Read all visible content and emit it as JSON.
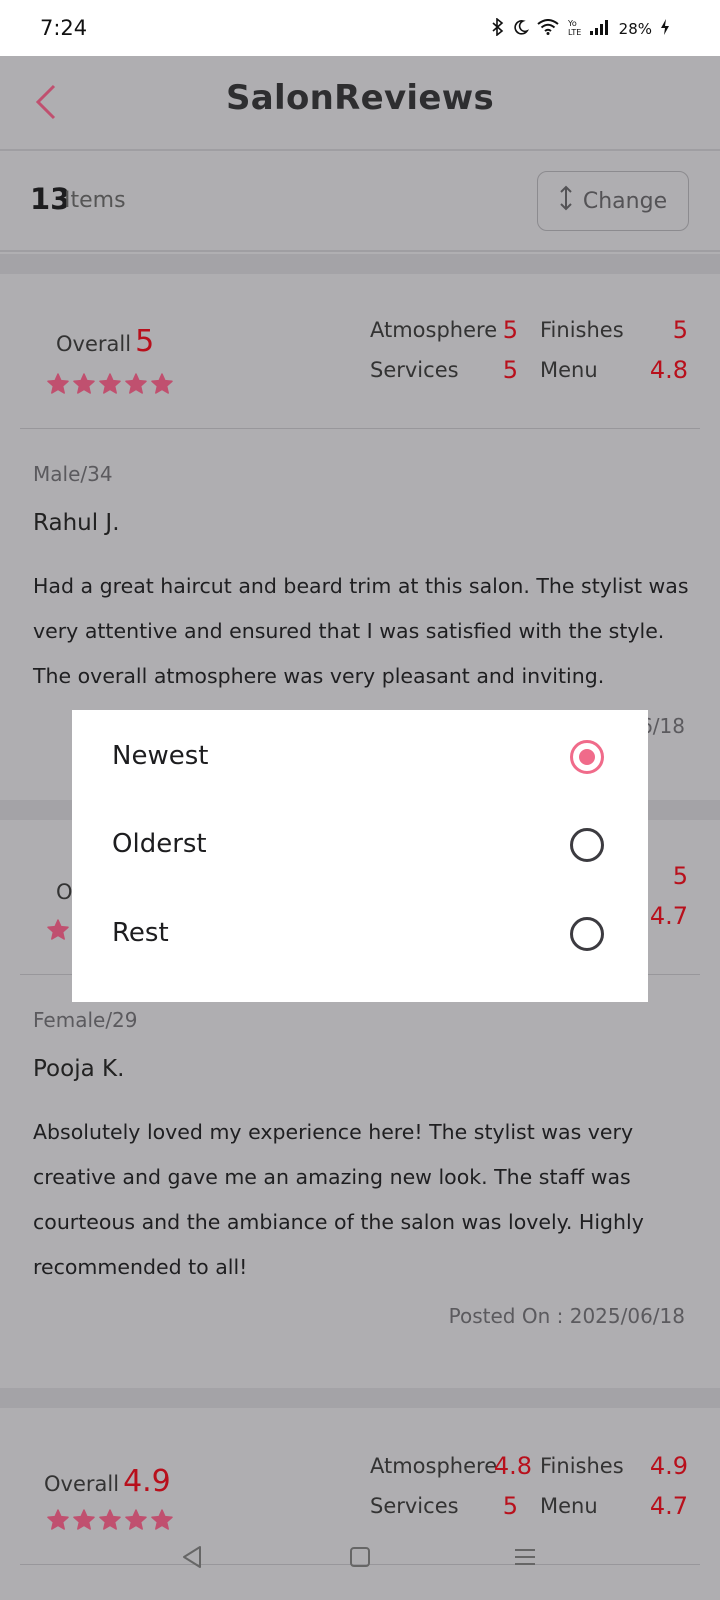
{
  "status_bar": {
    "time": "7:24",
    "icons": [
      "bluetooth-icon",
      "moon-icon",
      "wifi-icon",
      "volte-icon",
      "signal-icon"
    ],
    "battery": "28%"
  },
  "header": {
    "title": "SalonReviews",
    "back_icon": "chevron-left-icon"
  },
  "items_bar": {
    "count": "13",
    "label": "Items",
    "change_label": "Change",
    "change_icon": "sort-arrows-icon"
  },
  "reviews": [
    {
      "overall_label": "Overall",
      "overall_value": "5",
      "stars": 5,
      "metrics": [
        {
          "label": "Atmosphere",
          "value": "5"
        },
        {
          "label": "Finishes",
          "value": "5"
        },
        {
          "label": "Services",
          "value": "5"
        },
        {
          "label": "Menu",
          "value": "4.8"
        }
      ],
      "demographic": "Male/34",
      "name": "Rahul J.",
      "text": "Had a great haircut and beard trim at this salon. The stylist was very attentive and ensured that I was satisfied with the style. The overall atmosphere was very pleasant and inviting.",
      "posted_partial": "6/18"
    },
    {
      "overall_label_partial": "O",
      "metric_values_partial": [
        "5",
        "4.7"
      ],
      "demographic": "Female/29",
      "name": "Pooja K.",
      "text": "Absolutely loved my experience here! The stylist was very creative and gave me an amazing new look. The staff was courteous and the ambiance of the salon was lovely. Highly recommended to all!",
      "posted": "Posted On : 2025/06/18"
    },
    {
      "overall_label": "Overall",
      "overall_value": "4.9",
      "stars": 5,
      "metrics": [
        {
          "label": "Atmosphere",
          "value": "4.8"
        },
        {
          "label": "Finishes",
          "value": "4.9"
        },
        {
          "label": "Services",
          "value": "5"
        },
        {
          "label": "Menu",
          "value": "4.7"
        }
      ]
    }
  ],
  "sort_dialog": {
    "options": [
      {
        "label": "Newest",
        "selected": true
      },
      {
        "label": "Olderst",
        "selected": false
      },
      {
        "label": "Rest",
        "selected": false
      }
    ]
  },
  "colors": {
    "accent": "#f06b8a",
    "rating": "#b8101c",
    "star": "#c0506f",
    "scrim": "#b0afb2"
  },
  "nav_bar": {
    "icons": [
      "back-triangle-icon",
      "home-square-icon",
      "recents-menu-icon"
    ]
  }
}
